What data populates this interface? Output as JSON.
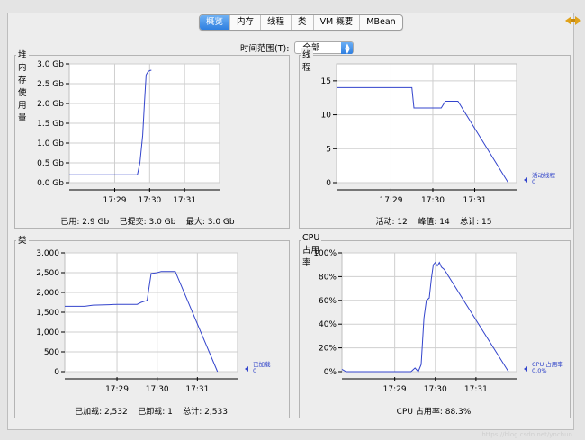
{
  "tabs": [
    {
      "label": "概览",
      "active": true
    },
    {
      "label": "内存",
      "active": false
    },
    {
      "label": "线程",
      "active": false
    },
    {
      "label": "类",
      "active": false
    },
    {
      "label": "VM 概要",
      "active": false
    },
    {
      "label": "MBean",
      "active": false
    }
  ],
  "time_range": {
    "label": "时间范围(T):",
    "value": "全部"
  },
  "colors": {
    "series": "#3344cc",
    "grid": "#cfcfcf",
    "tab_active": "#2f7fe0"
  },
  "watermark": "https://blog.csdn.net/ynchun",
  "chart_data": [
    {
      "type": "line",
      "title": "堆内存使用量",
      "y_ticks": [
        "3.0 Gb",
        "2.5 Gb",
        "2.0 Gb",
        "1.5 Gb",
        "1.0 Gb",
        "0.5 Gb",
        "0.0 Gb"
      ],
      "y_tick_values": [
        3.0,
        2.5,
        2.0,
        1.5,
        1.0,
        0.5,
        0.0
      ],
      "ylim": [
        0,
        3.0
      ],
      "x_ticks": [
        "17:29",
        "17:30",
        "17:31"
      ],
      "x_tick_values": [
        1769,
        1770,
        1771
      ],
      "xlim": [
        1767.7,
        1772.0
      ],
      "series": [
        {
          "x": [
            1767.7,
            1768.2,
            1768.8,
            1769.4,
            1769.65,
            1769.72,
            1769.8,
            1769.85,
            1769.9,
            1769.95,
            1770.0,
            1770.05
          ],
          "y": [
            0.2,
            0.2,
            0.2,
            0.2,
            0.2,
            0.5,
            1.2,
            2.0,
            2.72,
            2.8,
            2.83,
            2.84
          ]
        }
      ],
      "legend": {
        "name": "",
        "value": ""
      },
      "summary": [
        "已用: 2.9 Gb",
        "已提交: 3.0 Gb",
        "最大: 3.0 Gb"
      ]
    },
    {
      "type": "line",
      "title": "线程",
      "y_ticks": [
        "15",
        "10",
        "5",
        "0"
      ],
      "y_tick_values": [
        15,
        10,
        5,
        0
      ],
      "ylim": [
        0,
        17.5
      ],
      "x_ticks": [
        "17:29",
        "17:30",
        "17:31"
      ],
      "x_tick_values": [
        1769,
        1770,
        1771
      ],
      "xlim": [
        1767.7,
        1772.0
      ],
      "series": [
        {
          "x": [
            1767.7,
            1768.5,
            1769.0,
            1769.5,
            1769.55,
            1770.0,
            1770.2,
            1770.3,
            1770.6,
            1771.8
          ],
          "y": [
            14,
            14,
            14,
            14,
            11,
            11,
            11,
            12,
            12,
            0
          ]
        }
      ],
      "legend": {
        "name": "活动线程",
        "value": "0"
      },
      "summary": [
        "活动: 12",
        "峰值: 14",
        "总计: 15"
      ]
    },
    {
      "type": "line",
      "title": "类",
      "y_ticks": [
        "3,000",
        "2,500",
        "2,000",
        "1,500",
        "1,000",
        "500",
        "0"
      ],
      "y_tick_values": [
        3000,
        2500,
        2000,
        1500,
        1000,
        500,
        0
      ],
      "ylim": [
        0,
        3000
      ],
      "x_ticks": [
        "17:29",
        "17:30",
        "17:31"
      ],
      "x_tick_values": [
        1769,
        1770,
        1771
      ],
      "xlim": [
        1767.7,
        1772.0
      ],
      "series": [
        {
          "x": [
            1767.7,
            1768.2,
            1768.4,
            1768.8,
            1769.0,
            1769.5,
            1769.6,
            1769.75,
            1769.85,
            1770.0,
            1770.1,
            1770.45,
            1771.5
          ],
          "y": [
            1650,
            1650,
            1680,
            1690,
            1700,
            1700,
            1750,
            1800,
            2480,
            2500,
            2530,
            2530,
            0
          ]
        }
      ],
      "legend": {
        "name": "已加载",
        "value": "0"
      },
      "summary": [
        "已加载: 2,532",
        "已卸载: 1",
        "总计: 2,533"
      ]
    },
    {
      "type": "line",
      "title": "CPU 占用率",
      "y_ticks": [
        "100%",
        "80%",
        "60%",
        "40%",
        "20%",
        "0%"
      ],
      "y_tick_values": [
        100,
        80,
        60,
        40,
        20,
        0
      ],
      "ylim": [
        0,
        100
      ],
      "x_ticks": [
        "17:29",
        "17:30",
        "17:31"
      ],
      "x_tick_values": [
        1769,
        1770,
        1771
      ],
      "xlim": [
        1767.7,
        1772.0
      ],
      "series": [
        {
          "x": [
            1767.7,
            1767.8,
            1768.2,
            1768.7,
            1769.2,
            1769.4,
            1769.5,
            1769.58,
            1769.65,
            1769.72,
            1769.78,
            1769.85,
            1769.9,
            1769.95,
            1770.0,
            1770.05,
            1770.1,
            1770.15,
            1770.22,
            1771.8
          ],
          "y": [
            2,
            0,
            0,
            0,
            0,
            0,
            3,
            0,
            6,
            45,
            60,
            62,
            78,
            90,
            92,
            89,
            92,
            88,
            86,
            0
          ]
        }
      ],
      "legend": {
        "name": "CPU 占用率",
        "value": "0.0%"
      },
      "summary": [
        "CPU 占用率: 88.3%"
      ]
    }
  ]
}
